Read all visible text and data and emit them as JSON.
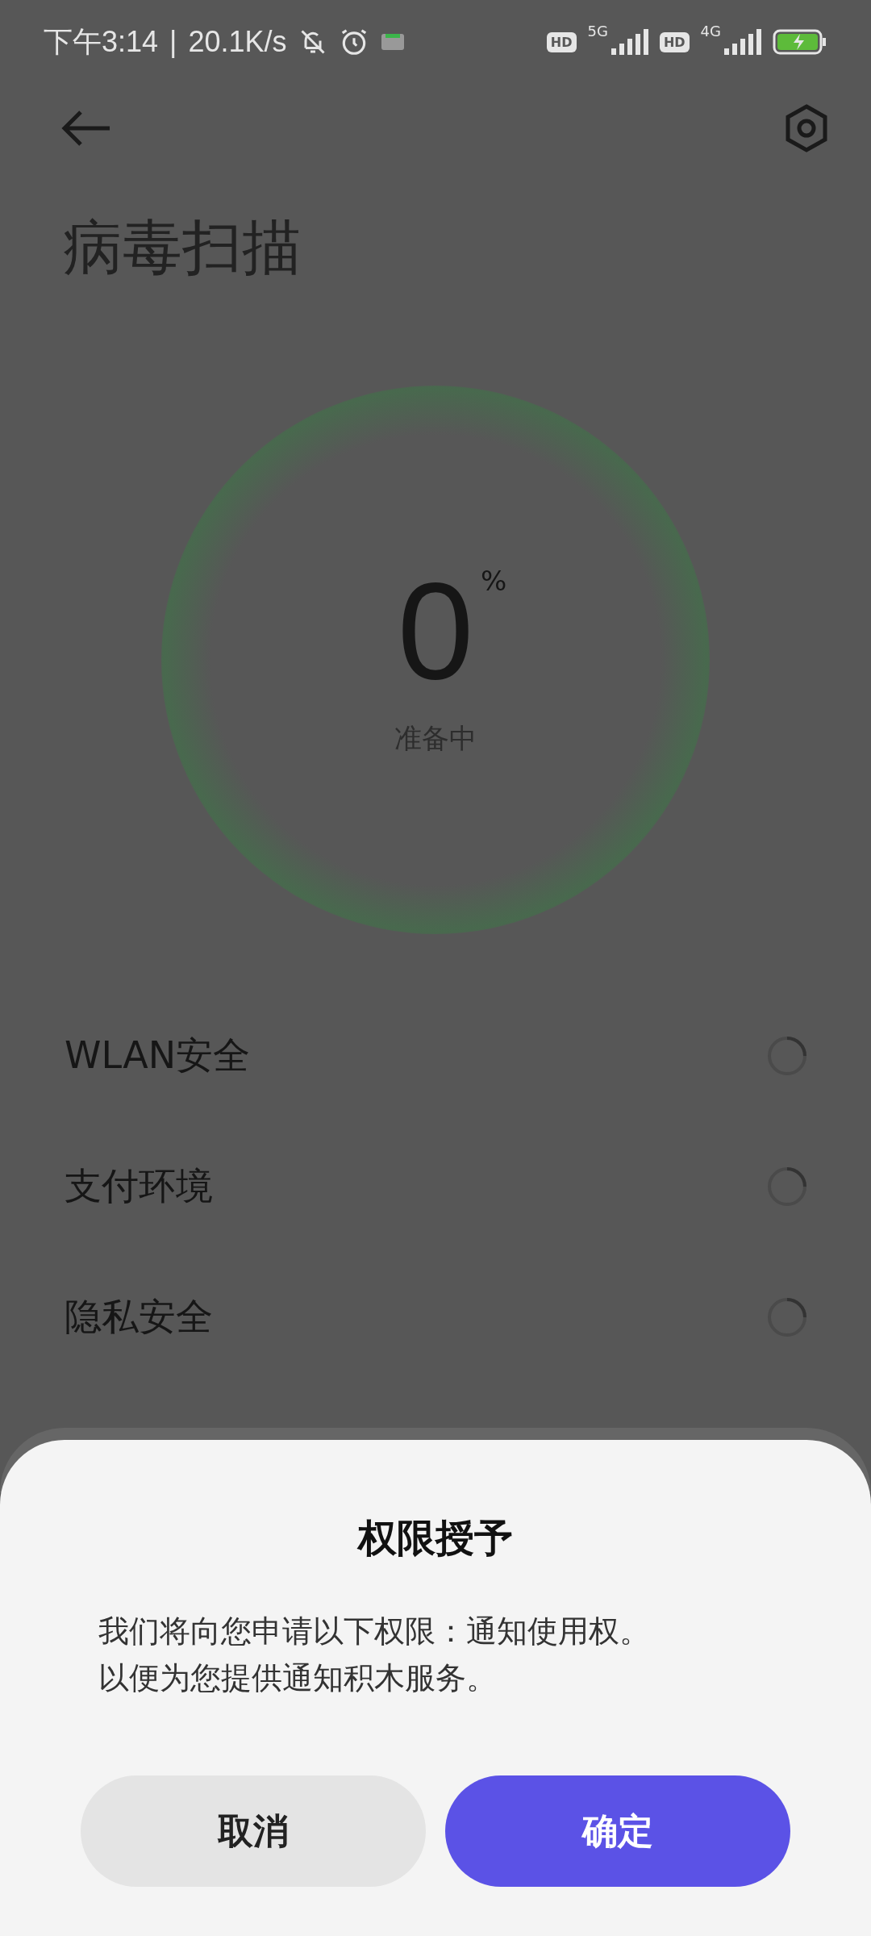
{
  "status_bar": {
    "time": "下午3:14",
    "separator": "|",
    "speed": "20.1K/s",
    "hd_1": "HD",
    "network_1": "5G",
    "hd_2": "HD",
    "network_2": "4G"
  },
  "header": {
    "title": "病毒扫描"
  },
  "progress": {
    "value": "0",
    "unit": "%",
    "status": "准备中"
  },
  "scan_items": [
    {
      "label": "WLAN安全"
    },
    {
      "label": "支付环境"
    },
    {
      "label": "隐私安全"
    }
  ],
  "dialog": {
    "title": "权限授予",
    "message": [
      "我们将向您申请以下权限：通知使用权。",
      "以便为您提供通知积木服务。"
    ],
    "buttons": [
      {
        "label": "取消",
        "kind": "secondary"
      },
      {
        "label": "确定",
        "kind": "primary"
      }
    ]
  }
}
